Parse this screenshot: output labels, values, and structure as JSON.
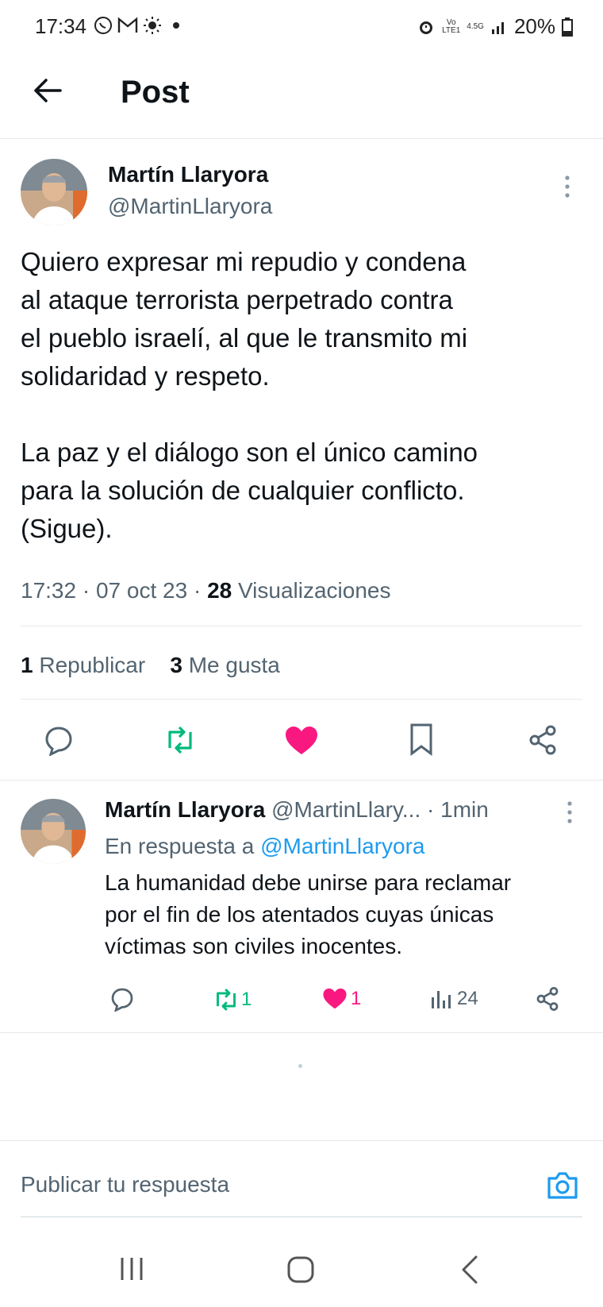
{
  "status_bar": {
    "time": "17:34",
    "battery": "20%",
    "network": "4.5G",
    "left_icons": [
      "whatsapp-icon",
      "gmail-icon",
      "sun-icon",
      "dot-icon"
    ],
    "right_icons": [
      "alarm-icon",
      "volte-icon",
      "signal-icon",
      "battery-icon"
    ]
  },
  "header": {
    "title": "Post"
  },
  "main_post": {
    "author_name": "Martín Llaryora",
    "handle": "@MartinLlaryora",
    "text": "Quiero expresar mi repudio y condena\nal ataque terrorista perpetrado contra\nel pueblo israelí, al que le transmito mi\nsolidaridad y respeto.\n\nLa paz y el diálogo son el único camino\npara la solución de cualquier conflicto.\n(Sigue).",
    "time": "17:32",
    "date": "07 oct 23",
    "views_count": "28",
    "views_label": "Visualizaciones",
    "reposts_count": "1",
    "reposts_label": "Republicar",
    "likes_count": "3",
    "likes_label": "Me gusta"
  },
  "reply_post": {
    "author_name": "Martín Llaryora",
    "handle": "@MartinLlary...",
    "time": "· 1min",
    "in_reply_prefix": "En respuesta a",
    "in_reply_handle": "@MartinLlaryora",
    "text": "La humanidad debe unirse para reclamar\npor el fin de los atentados cuyas únicas\nvíctimas son civiles inocentes.",
    "reposts": "1",
    "likes": "1",
    "views": "24"
  },
  "reply_bar": {
    "placeholder": "Publicar tu respuesta"
  },
  "colors": {
    "accent": "#1d9bf0",
    "repost_green": "#00ba7c",
    "like_pink": "#f91880",
    "secondary_text": "#536471"
  }
}
